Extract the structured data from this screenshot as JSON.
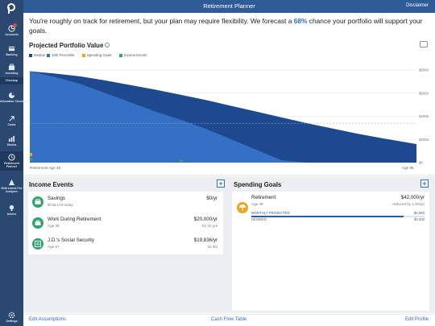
{
  "app": {
    "title": "Retirement Planner",
    "disclaimer": "Disclaimer"
  },
  "sidebar": {
    "items": [
      {
        "label": "Accounts",
        "icon": "accounts-icon",
        "badge": true
      },
      {
        "label": "Banking",
        "icon": "banking-icon"
      },
      {
        "label": "Investing",
        "icon": "investing-icon"
      },
      {
        "label": "Checkup",
        "icon": "checkup-icon"
      },
      {
        "label": "Allocation Checkup",
        "icon": "allocation-icon"
      },
      {
        "label": "Costs",
        "icon": "costs-icon"
      },
      {
        "label": "Stocks",
        "icon": "stocks-icon"
      },
      {
        "label": "Retirement Planner",
        "icon": "retirement-icon",
        "active": true
      },
      {
        "label": "Retirement Fee Analyzer",
        "icon": "fee-analyzer-icon"
      },
      {
        "label": "Advice",
        "icon": "advice-icon"
      },
      {
        "label": "Settings",
        "icon": "settings-icon"
      }
    ]
  },
  "summary": {
    "before": "You're roughly on track for retirement, but your plan may require flexibility. We forecast a ",
    "pct": "68%",
    "after": " chance your portfolio will support your goals."
  },
  "projection": {
    "title": "Projected Portfolio Value",
    "legend": [
      {
        "label": "Median",
        "color": "#1d4a8f"
      },
      {
        "label": "10th Percentile",
        "color": "#3570c4"
      },
      {
        "label": "Spending Goals",
        "color": "#f2a324"
      },
      {
        "label": "Income Events",
        "color": "#2fa46d"
      }
    ]
  },
  "chart_data": {
    "type": "area",
    "x_start_label": "Retirement Age 49",
    "x_end_label": "Age 95",
    "x": [
      49,
      52,
      55,
      58,
      61,
      64,
      67,
      70,
      73,
      76,
      79,
      82,
      85,
      88,
      91,
      95
    ],
    "yticks": [
      "$800K",
      "$600K",
      "$400K",
      "$200K",
      "$0"
    ],
    "ylim": [
      0,
      800000
    ],
    "series": [
      {
        "name": "Median",
        "values": [
          790000,
          770000,
          745000,
          710000,
          670000,
          630000,
          585000,
          540000,
          490000,
          440000,
          390000,
          340000,
          295000,
          250000,
          210000,
          160000
        ]
      },
      {
        "name": "10th Percentile",
        "values": [
          790000,
          740000,
          680000,
          600000,
          520000,
          440000,
          370000,
          290000,
          200000,
          110000,
          20000,
          0,
          0,
          0,
          0,
          0
        ]
      }
    ],
    "legend_position": "top-left",
    "grid": true
  },
  "income": {
    "title": "Income Events",
    "items": [
      {
        "name": "Savings",
        "sub": "$735,170 today",
        "amount": "$0/yr",
        "duration": ""
      },
      {
        "name": "Work During Retirement",
        "sub": "Age 49",
        "amount": "$20,000/yr",
        "duration": "for 10 yrs"
      },
      {
        "name": "J.D.'s Social Security",
        "sub": "Age 67",
        "amount": "$19,836/yr",
        "duration": "for life"
      }
    ]
  },
  "spending": {
    "title": "Spending Goals",
    "item": {
      "name": "Retirement",
      "sub": "Age 49",
      "amount": "$42,000/yr",
      "duration": "reduced by 1.0%/yr",
      "projected_label": "MONTHLY PROJECTED",
      "projected_value": "$3,083",
      "desired_label": "DESIRED",
      "desired_value": "$3,500",
      "projected_fraction": 0.88
    }
  },
  "footer": {
    "left": "Edit Assumptions",
    "center": "Cash Flow Table",
    "right": "Edit Profile"
  }
}
